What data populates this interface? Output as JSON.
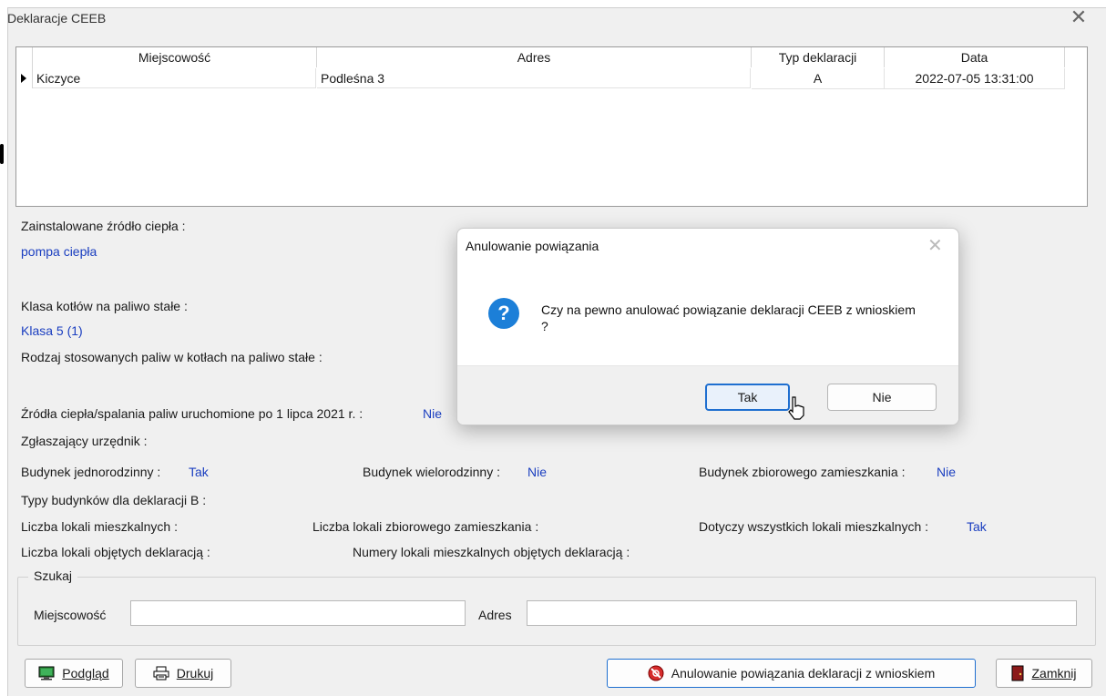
{
  "window": {
    "title": "Deklaracje CEEB",
    "close": "✕"
  },
  "grid": {
    "columns": [
      "Miejscowość",
      "Adres",
      "Typ deklaracji",
      "Data"
    ],
    "rows": [
      {
        "miejscowosc": "Kiczyce",
        "adres": "Podleśna 3",
        "typ": "A",
        "data": "2022-07-05 13:31:00"
      }
    ]
  },
  "details": {
    "zrodlo_label": "Zainstalowane źródło ciepła :",
    "zrodlo_value": "pompa ciepła",
    "klasa_label": "Klasa kotłów na paliwo stałe :",
    "klasa_value": "Klasa 5 (1)",
    "rodzaj_label": "Rodzaj stosowanych paliw w kotłach na paliwo stałe :",
    "zrodla_2021_label": "Źródła ciepła/spalania paliw uruchomione po 1 lipca 2021 r. :",
    "zrodla_2021_value": "Nie",
    "urzednik_label": "Zgłaszający urzędnik :",
    "jednorodzinny_label": "Budynek jednorodzinny :",
    "jednorodzinny_value": "Tak",
    "wielorodzinny_label": "Budynek wielorodzinny :",
    "wielorodzinny_value": "Nie",
    "zbiorowy_label": "Budynek zbiorowego zamieszkania :",
    "zbiorowy_value": "Nie",
    "typy_b_label": "Typy budynków dla deklaracji B :",
    "lokale_label": "Liczba lokali mieszkalnych :",
    "lokale_zbiorowe_label": "Liczba lokali zbiorowego zamieszkania :",
    "wszystkie_label": "Dotyczy wszystkich lokali mieszkalnych :",
    "wszystkie_value": "Tak",
    "objete_label": "Liczba lokali objętych deklaracją :",
    "numery_label": "Numery lokali mieszkalnych objętych deklaracją :"
  },
  "search": {
    "legend": "Szukaj",
    "miejscowosc_label": "Miejscowość",
    "miejscowosc_value": "",
    "adres_label": "Adres",
    "adres_value": ""
  },
  "buttons": {
    "podglad": "Podgląd",
    "drukuj": "Drukuj",
    "anulowanie": "Anulowanie powiązania deklaracji z wnioskiem",
    "zamknij": "Zamknij"
  },
  "dialog": {
    "title": "Anulowanie powiązania",
    "message": "Czy na pewno anulować powiązanie deklaracji CEEB z wnioskiem ?",
    "icon": "?",
    "yes": "Tak",
    "no": "Nie",
    "close": "✕"
  },
  "icons": {
    "podglad": "monitor-icon",
    "drukuj": "printer-icon",
    "anulowanie": "cancel-link-icon",
    "zamknij": "door-icon",
    "dialog": "question-icon"
  },
  "colors": {
    "accent": "#1f6fd0",
    "value_text": "#1a3ec0",
    "question_icon": "#1c7fd8",
    "cancel_icon": "#d62b2b"
  }
}
